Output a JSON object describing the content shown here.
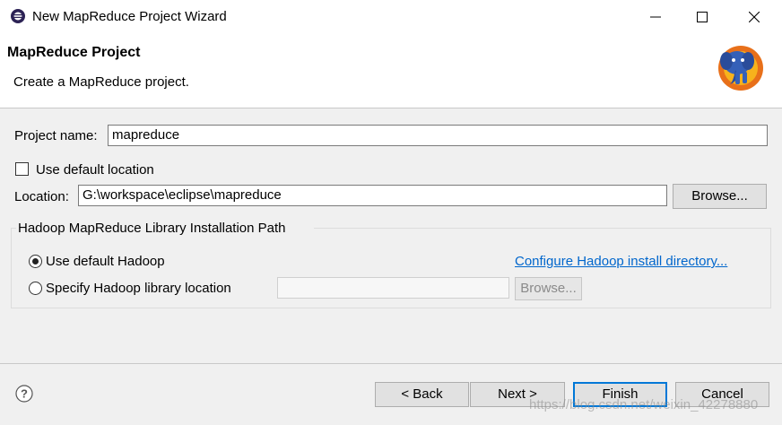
{
  "window": {
    "title": "New MapReduce Project Wizard",
    "minimize_icon": "minimize-icon",
    "maximize_icon": "maximize-icon",
    "close_icon": "close-icon"
  },
  "header": {
    "title": "MapReduce Project",
    "description": "Create a MapReduce project."
  },
  "form": {
    "project_name_label": "Project name:",
    "project_name_value": "mapreduce",
    "use_default_location_label": "Use default location",
    "use_default_location_checked": false,
    "location_label": "Location:",
    "location_value": "G:\\workspace\\eclipse\\mapreduce",
    "browse_label": "Browse..."
  },
  "hadoop_group": {
    "title": "Hadoop MapReduce Library Installation Path",
    "use_default_label": "Use default Hadoop",
    "use_default_selected": true,
    "configure_link": "Configure Hadoop install directory...",
    "specify_label": "Specify Hadoop library location",
    "specify_value": "",
    "browse_label": "Browse..."
  },
  "footer": {
    "help_icon": "help-icon",
    "back_label": "< Back",
    "next_label": "Next >",
    "finish_label": "Finish",
    "cancel_label": "Cancel"
  },
  "watermark": "https://blog.csdn.net/weixin_42278880",
  "colors": {
    "accent": "#0078d7",
    "link": "#0066cc",
    "background": "#f0f0f0"
  }
}
